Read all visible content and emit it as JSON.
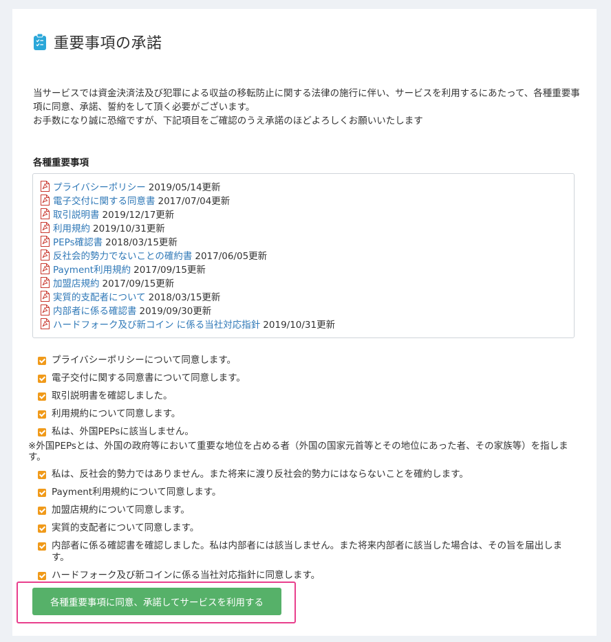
{
  "header": {
    "title": "重要事項の承諾",
    "icon": "clipboard-checklist-icon"
  },
  "intro": {
    "line1": "当サービスでは資金決済法及び犯罪による収益の移転防止に関する法律の施行に伴い、サービスを利用するにあたって、各種重要事項に同意、承諾、誓約をして頂く必要がございます。",
    "line2": "お手数になり誠に恐縮ですが、下記項目をご確認のうえ承諾のほどよろしくお願いいたします"
  },
  "documents": {
    "heading": "各種重要事項",
    "icon": "pdf-icon",
    "items": [
      {
        "name": "プライバシーポリシー",
        "date": "2019/05/14更新"
      },
      {
        "name": "電子交付に関する同意書",
        "date": "2017/07/04更新"
      },
      {
        "name": "取引説明書",
        "date": "2019/12/17更新"
      },
      {
        "name": "利用規約",
        "date": "2019/10/31更新"
      },
      {
        "name": "PEPs確認書",
        "date": "2018/03/15更新"
      },
      {
        "name": "反社会的勢力でないことの確約書",
        "date": "2017/06/05更新"
      },
      {
        "name": "Payment利用規約",
        "date": "2017/09/15更新"
      },
      {
        "name": "加盟店規約",
        "date": "2017/09/15更新"
      },
      {
        "name": "実質的支配者について",
        "date": "2018/03/15更新"
      },
      {
        "name": "内部者に係る確認書",
        "date": "2019/09/30更新"
      },
      {
        "name": "ハードフォーク及び新コイン に係る当社対応指針",
        "date": "2019/10/31更新"
      }
    ]
  },
  "agreements": {
    "accent_color": "#f09a1a",
    "items": [
      {
        "text": "プライバシーポリシーについて同意します。"
      },
      {
        "text": "電子交付に関する同意書について同意します。"
      },
      {
        "text": "取引説明書を確認しました。"
      },
      {
        "text": "利用規約について同意します。"
      },
      {
        "text": "私は、外国PEPsに該当しません。"
      },
      {
        "text": "私は、反社会的勢力ではありません。また将来に渡り反社会的勢力にはならないことを確約します。"
      },
      {
        "text": "Payment利用規約について同意します。"
      },
      {
        "text": "加盟店規約について同意します。"
      },
      {
        "text": "実質的支配者について同意します。"
      },
      {
        "text": "内部者に係る確認書を確認しました。私は内部者には該当しません。また将来内部者に該当した場合は、その旨を届出します。"
      },
      {
        "text": "ハードフォーク及び新コインに係る当社対応指針に同意します。"
      }
    ],
    "peps_note": "※外国PEPsとは、外国の政府等において重要な地位を占める者（外国の国家元首等とその地位にあった者、その家族等）を指します。"
  },
  "submit": {
    "label": "各種重要事項に同意、承諾してサービスを利用する",
    "color": "#56b169",
    "highlight_color": "#e83e8c"
  }
}
